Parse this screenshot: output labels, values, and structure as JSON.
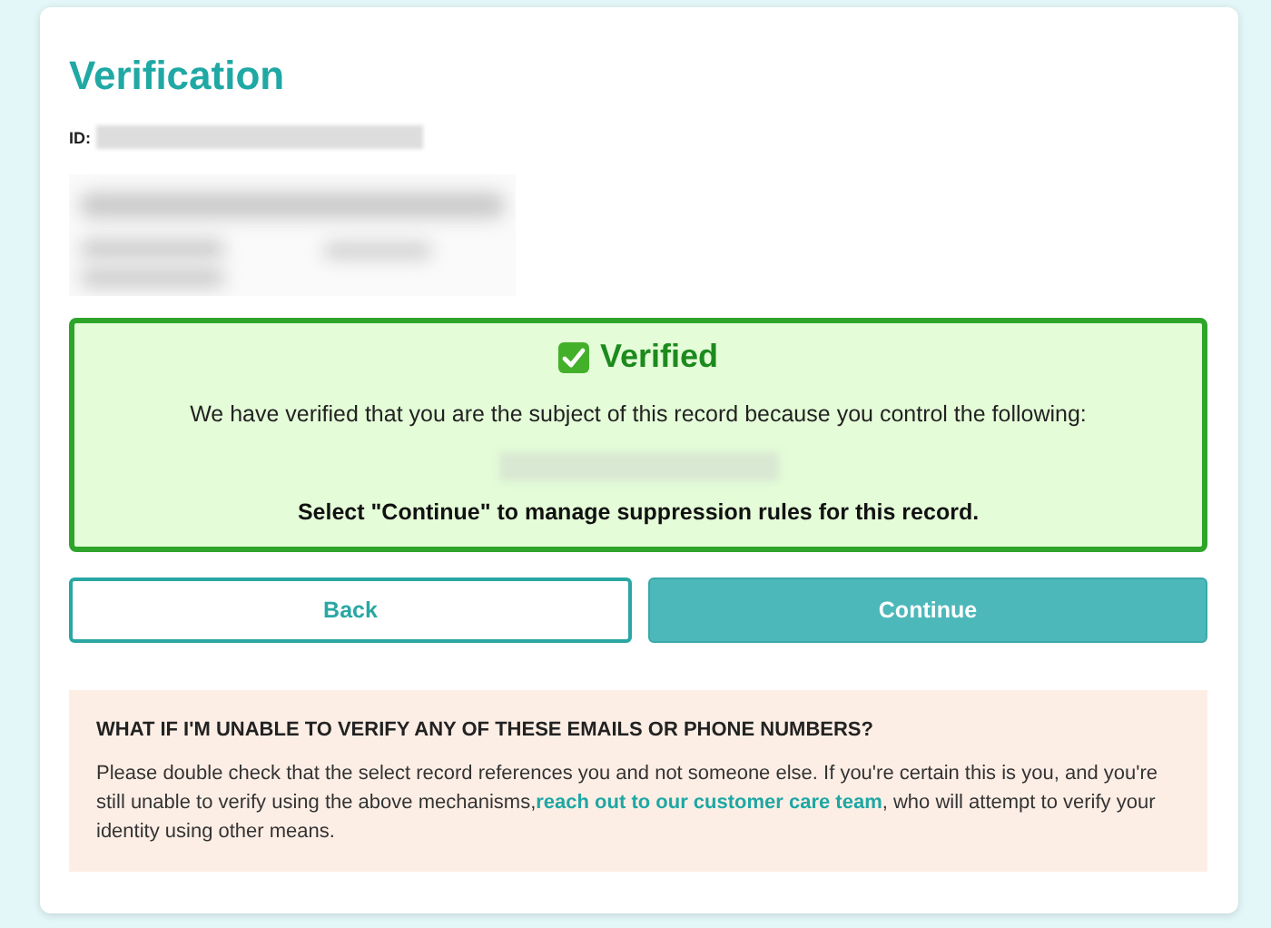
{
  "title": "Verification",
  "id_label": "ID:",
  "status": {
    "verified": true,
    "heading": "Verified",
    "message": "We have verified that you are the subject of this record because you control the following:",
    "instruction": "Select \"Continue\" to manage suppression rules for this record."
  },
  "buttons": [
    {
      "label": "Back",
      "kind": "secondary"
    },
    {
      "label": "Continue",
      "kind": "primary"
    }
  ],
  "help": {
    "heading": "WHAT IF I'M UNABLE TO VERIFY ANY OF THESE EMAILS OR PHONE NUMBERS?",
    "text_before": "Please double check that the select record references you and not someone else. If you're certain this is you, and you're still unable to verify using the above mechanisms,",
    "link": "reach out to our customer care team",
    "text_after": ", who will attempt to verify your identity using other means."
  }
}
